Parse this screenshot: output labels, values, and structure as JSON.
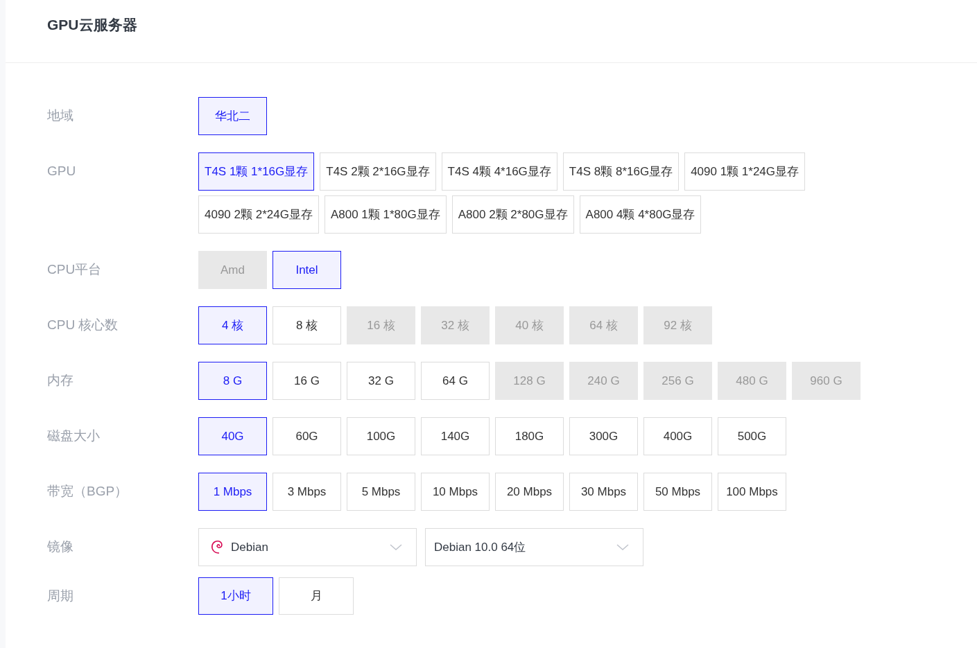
{
  "page_title": "GPU云服务器",
  "option_rows": [
    {
      "label": "地域",
      "options": [
        {
          "text": "华北二",
          "selected": true,
          "disabled": false
        }
      ]
    },
    {
      "label": "GPU",
      "options": [
        {
          "text": "T4S 1颗 1*16G显存",
          "selected": true,
          "disabled": false
        },
        {
          "text": "T4S 2颗 2*16G显存",
          "selected": false,
          "disabled": false
        },
        {
          "text": "T4S 4颗 4*16G显存",
          "selected": false,
          "disabled": false
        },
        {
          "text": "T4S 8颗 8*16G显存",
          "selected": false,
          "disabled": false
        },
        {
          "text": "4090 1颗 1*24G显存",
          "selected": false,
          "disabled": false
        },
        {
          "text": "4090 2颗 2*24G显存",
          "selected": false,
          "disabled": false
        },
        {
          "text": "A800 1颗 1*80G显存",
          "selected": false,
          "disabled": false
        },
        {
          "text": "A800 2颗 2*80G显存",
          "selected": false,
          "disabled": false
        },
        {
          "text": "A800 4颗 4*80G显存",
          "selected": false,
          "disabled": false
        }
      ]
    },
    {
      "label": "CPU平台",
      "options": [
        {
          "text": "Amd",
          "selected": false,
          "disabled": true
        },
        {
          "text": "Intel",
          "selected": true,
          "disabled": false
        }
      ]
    },
    {
      "label": "CPU 核心数",
      "options": [
        {
          "text": "4 核",
          "selected": true,
          "disabled": false
        },
        {
          "text": "8 核",
          "selected": false,
          "disabled": false
        },
        {
          "text": "16 核",
          "selected": false,
          "disabled": true
        },
        {
          "text": "32 核",
          "selected": false,
          "disabled": true
        },
        {
          "text": "40 核",
          "selected": false,
          "disabled": true
        },
        {
          "text": "64 核",
          "selected": false,
          "disabled": true
        },
        {
          "text": "92 核",
          "selected": false,
          "disabled": true
        }
      ]
    },
    {
      "label": "内存",
      "options": [
        {
          "text": "8 G",
          "selected": true,
          "disabled": false
        },
        {
          "text": "16 G",
          "selected": false,
          "disabled": false
        },
        {
          "text": "32 G",
          "selected": false,
          "disabled": false
        },
        {
          "text": "64 G",
          "selected": false,
          "disabled": false
        },
        {
          "text": "128 G",
          "selected": false,
          "disabled": true
        },
        {
          "text": "240 G",
          "selected": false,
          "disabled": true
        },
        {
          "text": "256 G",
          "selected": false,
          "disabled": true
        },
        {
          "text": "480 G",
          "selected": false,
          "disabled": true
        },
        {
          "text": "960 G",
          "selected": false,
          "disabled": true
        }
      ]
    },
    {
      "label": "磁盘大小",
      "options": [
        {
          "text": "40G",
          "selected": true,
          "disabled": false
        },
        {
          "text": "60G",
          "selected": false,
          "disabled": false
        },
        {
          "text": "100G",
          "selected": false,
          "disabled": false
        },
        {
          "text": "140G",
          "selected": false,
          "disabled": false
        },
        {
          "text": "180G",
          "selected": false,
          "disabled": false
        },
        {
          "text": "300G",
          "selected": false,
          "disabled": false
        },
        {
          "text": "400G",
          "selected": false,
          "disabled": false
        },
        {
          "text": "500G",
          "selected": false,
          "disabled": false
        }
      ]
    },
    {
      "label": "带宽（BGP）",
      "options": [
        {
          "text": "1 Mbps",
          "selected": true,
          "disabled": false
        },
        {
          "text": "3 Mbps",
          "selected": false,
          "disabled": false
        },
        {
          "text": "5 Mbps",
          "selected": false,
          "disabled": false
        },
        {
          "text": "10 Mbps",
          "selected": false,
          "disabled": false
        },
        {
          "text": "20 Mbps",
          "selected": false,
          "disabled": false
        },
        {
          "text": "30 Mbps",
          "selected": false,
          "disabled": false
        },
        {
          "text": "50 Mbps",
          "selected": false,
          "disabled": false
        },
        {
          "text": "100 Mbps",
          "selected": false,
          "disabled": false
        }
      ]
    }
  ],
  "image": {
    "label": "镜像",
    "os_select": {
      "value": "Debian"
    },
    "version_select": {
      "value": "Debian 10.0 64位"
    }
  },
  "period": {
    "label": "周期",
    "options": [
      {
        "text": "1小时",
        "selected": true
      },
      {
        "text": "月",
        "selected": false
      }
    ]
  }
}
